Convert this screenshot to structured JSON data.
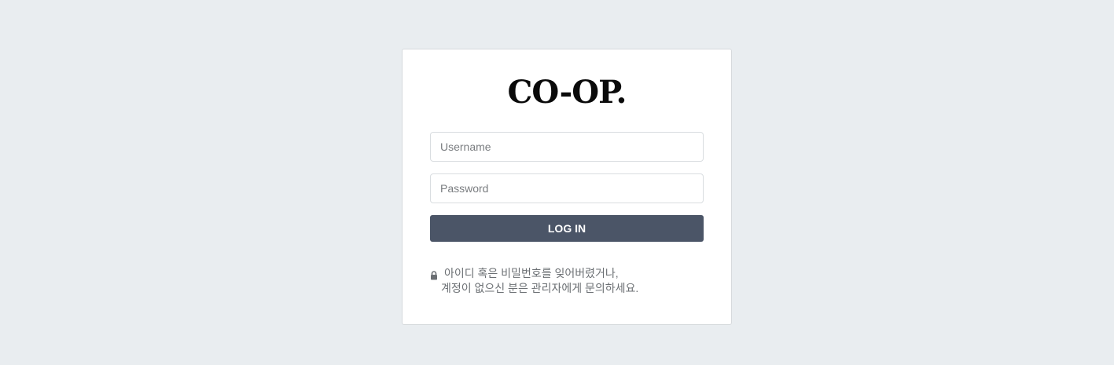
{
  "login": {
    "logo_text": "CO-OP.",
    "username_placeholder": "Username",
    "password_placeholder": "Password",
    "login_button": "LOG IN",
    "notice_line1": "아이디 혹은 비밀번호를 잊어버렸거나,",
    "notice_line2": "계정이 없으신 분은 관리자에게 문의하세요.",
    "notice_icon": "lock-icon"
  },
  "colors": {
    "background": "#e9edf0",
    "button": "#4b5567",
    "text_muted": "#6b6f73"
  }
}
